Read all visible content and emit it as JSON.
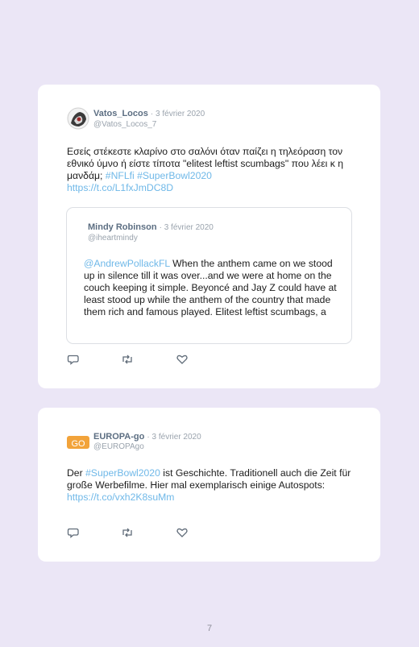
{
  "tweets": [
    {
      "author": "Vatos_Locos",
      "date": "· 3 février 2020",
      "handle": "@Vatos_Locos_7",
      "text_parts": {
        "plain1": "Εσείς στέκεστε κλαρίνο στο σαλόνι όταν παίζει η τηλεόραση τον εθνικό ύμνο ή είστε τίποτα \"elitest leftist scumbags\" που λέει κ η μανδάμ; ",
        "hashtag1": "#NFLfi",
        "space": " ",
        "hashtag2": "#SuperBowl2020",
        "url": "https://t.co/L1fxJmDC8D"
      },
      "quote": {
        "author": "Mindy Robinson",
        "date": "· 3 février 2020",
        "handle": "@iheartmindy",
        "mention": "@AndrewPollackFL",
        "text": " When the anthem came on we stood up in silence till it was over...and we were at home on the couch keeping it simple. Beyoncé and Jay Z could have at least stood up while the anthem of the country that made them rich and famous played. Elitest leftist scumbags, a"
      },
      "icons": [
        "reply-icon",
        "retweet-icon",
        "like-icon"
      ]
    },
    {
      "author": "EUROPA-go",
      "date": "· 3 février 2020",
      "handle": "@EUROPAgo",
      "avatar_text": "GO",
      "text_parts": {
        "plain1": "Der ",
        "hashtag": "#SuperBowl2020",
        "plain2": " ist Geschichte. Traditionell auch die Zeit für große Werbefilme. Hier mal exemplarisch einige Autospots: ",
        "url": "https://t.co/vxh2K8suMm"
      },
      "icons": [
        "reply-icon",
        "retweet-icon",
        "like-icon"
      ]
    }
  ],
  "page_number": "7",
  "colors": {
    "background": "#ebe6f6",
    "link": "#6fb8e8",
    "name": "#5c6e82"
  }
}
